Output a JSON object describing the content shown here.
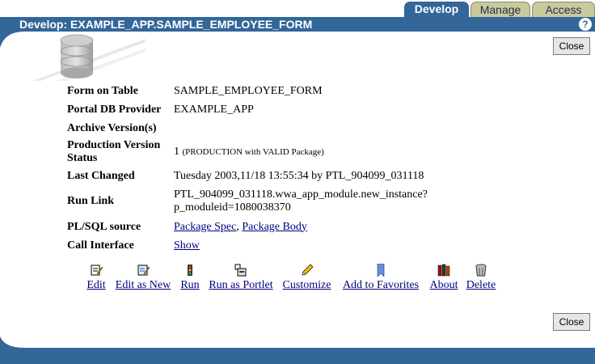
{
  "tabs": [
    {
      "label": "Develop"
    },
    {
      "label": "Manage"
    },
    {
      "label": "Access"
    }
  ],
  "header": {
    "title": "Develop: EXAMPLE_APP.SAMPLE_EMPLOYEE_FORM"
  },
  "buttons": {
    "close_top": "Close",
    "close_bottom": "Close"
  },
  "info": {
    "form_on_table": {
      "label": "Form on Table",
      "value": "SAMPLE_EMPLOYEE_FORM"
    },
    "provider": {
      "label": "Portal DB Provider",
      "value": "EXAMPLE_APP"
    },
    "archive": {
      "label": "Archive Version(s)",
      "value": ""
    },
    "production": {
      "label_line1": "Production Version",
      "label_line2": "Status",
      "version": "1",
      "status": "(PRODUCTION with VALID Package)"
    },
    "last_changed": {
      "label": "Last Changed",
      "value": "Tuesday 2003,11/18 13:55:34 by PTL_904099_031118"
    },
    "run_link": {
      "label": "Run Link",
      "line1": "PTL_904099_031118.wwa_app_module.new_instance?",
      "line2": "p_moduleid=1080038370"
    },
    "plsql": {
      "label": "PL/SQL source",
      "spec": "Package Spec",
      "sep": ",",
      "body": "Package Body"
    },
    "call_interface": {
      "label": "Call Interface",
      "value": "Show"
    }
  },
  "actions": [
    {
      "label": "Edit",
      "icon": "edit-icon"
    },
    {
      "label": "Edit as New",
      "icon": "edit-as-new-icon"
    },
    {
      "label": "Run",
      "icon": "run-icon"
    },
    {
      "label": "Run as Portlet",
      "icon": "portlet-icon"
    },
    {
      "label": "Customize",
      "icon": "pencil-icon"
    },
    {
      "label": "Add to Favorites",
      "icon": "bookmark-icon"
    },
    {
      "label": "About",
      "icon": "books-icon"
    },
    {
      "label": "Delete",
      "icon": "trash-icon"
    }
  ],
  "colors": {
    "brand": "#336699",
    "tab_inactive": "#c9c99e",
    "link": "#000080"
  }
}
